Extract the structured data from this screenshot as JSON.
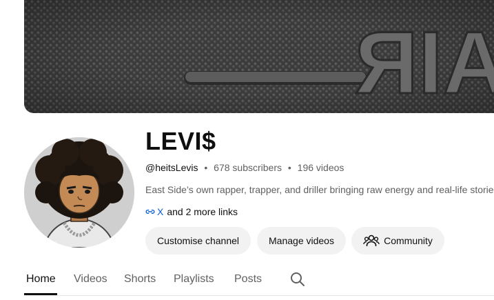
{
  "banner": {
    "emboss_text": "AIR"
  },
  "channel": {
    "name": "LEVI$",
    "handle": "@heitsLevis",
    "subscribers": "678 subscribers",
    "videos": "196 videos",
    "separator": "•",
    "description": "East Side’s own rapper, trapper, and driller bringing raw energy and real-life stories to the",
    "link_primary": "X",
    "link_more": "and 2 more links"
  },
  "buttons": {
    "customise": "Customise channel",
    "manage": "Manage videos",
    "community": "Community"
  },
  "tabs": [
    {
      "label": "Home",
      "active": true
    },
    {
      "label": "Videos"
    },
    {
      "label": "Shorts"
    },
    {
      "label": "Playlists"
    },
    {
      "label": "Posts"
    }
  ],
  "icons": {
    "link": "link-icon",
    "community": "people-icon",
    "search": "search-icon"
  },
  "colors": {
    "link_blue": "#065fd4",
    "button_bg": "#f2f2f2",
    "secondary_text": "#606060",
    "primary_text": "#0f0f0f"
  }
}
